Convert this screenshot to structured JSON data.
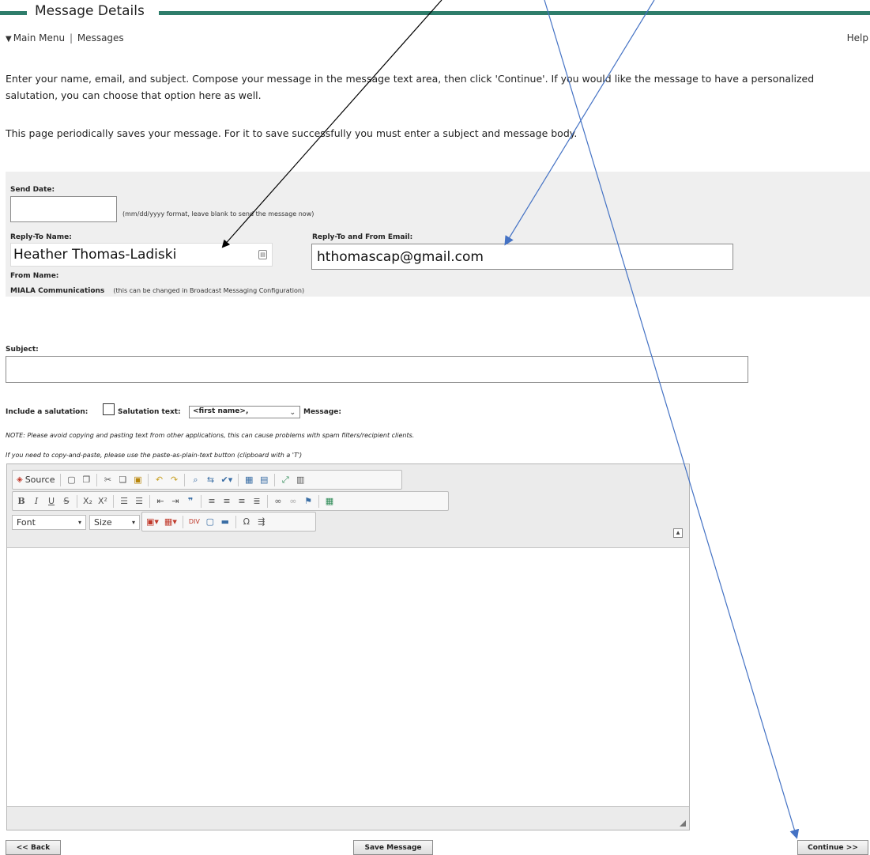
{
  "header": {
    "title": "Message Details"
  },
  "nav": {
    "main_menu": "Main Menu",
    "separator": "|",
    "messages": "Messages",
    "help": "Help"
  },
  "intro": {
    "paragraph1": "Enter your name, email, and subject. Compose your message in the message text area, then click 'Continue'. If you would like the message to have a personalized salutation, you can choose that option here as well.",
    "paragraph2": "This page periodically saves your message. For it to save successfully you must enter a subject and message body."
  },
  "form": {
    "send_date_label": "Send Date:",
    "send_date_value": "",
    "send_date_hint": "(mm/dd/yyyy format, leave blank to send the message now)",
    "reply_to_name_label": "Reply-To Name:",
    "reply_to_name_value": "Heather Thomas-Ladiski",
    "reply_to_email_label": "Reply-To and From Email:",
    "reply_to_email_value": "hthomascap@gmail.com",
    "from_name_label": "From Name:",
    "from_name_value": "MIALA Communications",
    "from_name_hint": "(this can be changed in Broadcast Messaging Configuration)",
    "subject_label": "Subject:",
    "subject_value": "",
    "include_salutation_label": "Include a salutation:",
    "salutation_text_label": "Salutation text:",
    "salutation_selected": "<first name>,",
    "message_label": "Message:",
    "note1": "NOTE: Please avoid copying and pasting text from other applications, this can cause problems with spam filters/recipient clients.",
    "note2": "If you need to copy-and-paste, please use the paste-as-plain-text button (clipboard with a 'T')"
  },
  "editor": {
    "source_label": "Source",
    "font_label": "Font",
    "size_label": "Size"
  },
  "buttons": {
    "back": "<< Back",
    "save": "Save Message",
    "continue": "Continue >>"
  },
  "colors": {
    "accent": "#2e7d6b",
    "panel_bg": "#efefef",
    "arrow_black": "#000000",
    "arrow_blue": "#4472c4"
  }
}
